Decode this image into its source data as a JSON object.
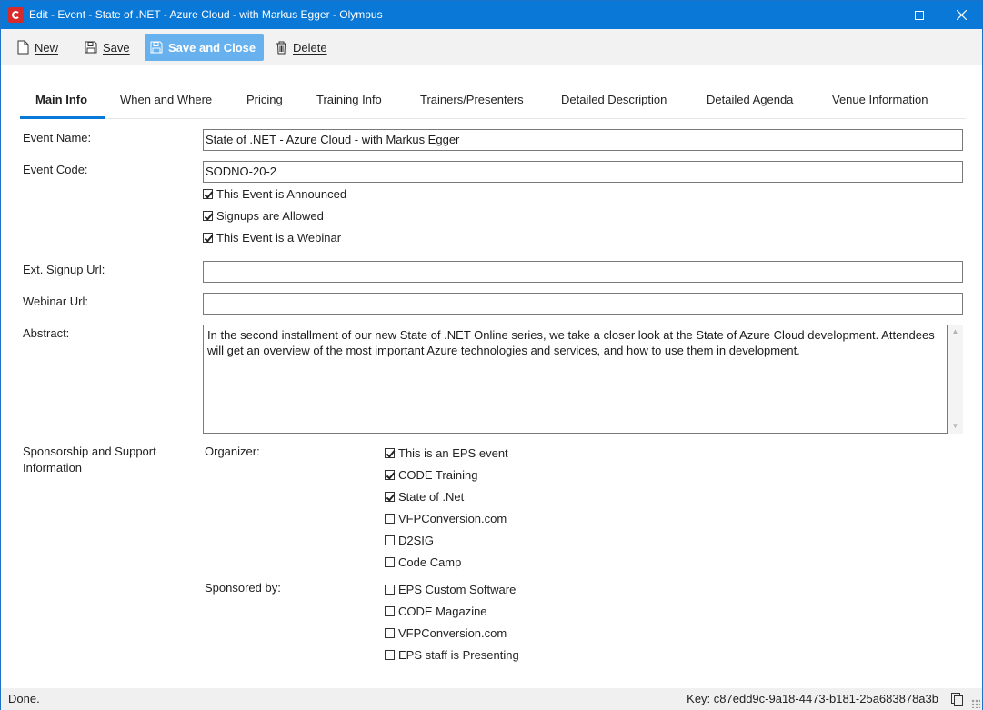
{
  "window": {
    "title": "Edit - Event - State of .NET - Azure Cloud - with Markus Egger - Olympus"
  },
  "toolbar": {
    "new_label": "New",
    "save_label": "Save",
    "save_close_label": "Save and Close",
    "delete_label": "Delete"
  },
  "tabs": [
    {
      "label": "Main Info",
      "active": true
    },
    {
      "label": "When and Where"
    },
    {
      "label": "Pricing"
    },
    {
      "label": "Training Info"
    },
    {
      "label": "Trainers/Presenters"
    },
    {
      "label": "Detailed Description"
    },
    {
      "label": "Detailed Agenda"
    },
    {
      "label": "Venue Information"
    }
  ],
  "form": {
    "event_name_label": "Event Name:",
    "event_name_value": "State of .NET - Azure Cloud - with Markus Egger",
    "event_code_label": "Event Code:",
    "event_code_value": "SODNO-20-2",
    "announced_label": "This Event is Announced",
    "signups_label": "Signups are Allowed",
    "webinar_label": "This Event is a Webinar",
    "ext_signup_label": "Ext. Signup Url:",
    "ext_signup_value": "",
    "webinar_url_label": "Webinar Url:",
    "webinar_url_value": "",
    "abstract_label": "Abstract:",
    "abstract_value": "In the second installment of our new State of .NET Online series, we take a closer look at the State of Azure Cloud development. Attendees will get an overview of the most important Azure technologies and services, and how to use them in development.",
    "sponsorship_label_line1": "Sponsorship and Support",
    "sponsorship_label_line2": "Information",
    "organizer_label": "Organizer:",
    "organizers": [
      {
        "label": "This is an EPS event",
        "checked": true
      },
      {
        "label": "CODE Training",
        "checked": true
      },
      {
        "label": "State of .Net",
        "checked": true
      },
      {
        "label": "VFPConversion.com",
        "checked": false
      },
      {
        "label": "D2SIG",
        "checked": false
      },
      {
        "label": "Code Camp",
        "checked": false
      }
    ],
    "sponsored_label": "Sponsored by:",
    "sponsors": [
      {
        "label": "EPS Custom Software",
        "checked": false
      },
      {
        "label": "CODE Magazine",
        "checked": false
      },
      {
        "label": "VFPConversion.com",
        "checked": false
      },
      {
        "label": "EPS staff is Presenting",
        "checked": false
      }
    ]
  },
  "status": {
    "left": "Done.",
    "key": "Key: c87edd9c-9a18-4473-b181-25a683878a3b"
  }
}
